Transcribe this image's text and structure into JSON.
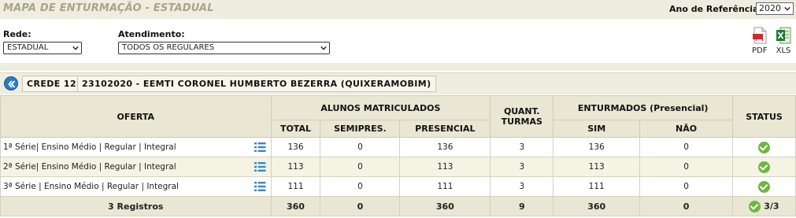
{
  "header": {
    "title": "MAPA DE ENTURMAÇÃO - ESTADUAL",
    "ano_label": "Ano de Referência:",
    "ano_value": "2020"
  },
  "filters": {
    "rede_label": "Rede:",
    "rede_value": "ESTADUAL",
    "atendimento_label": "Atendimento:",
    "atendimento_value": "TODOS OS REGULARES"
  },
  "export": {
    "pdf_label": "PDF",
    "xls_label": "XLS"
  },
  "breadcrumb": {
    "crede": "CREDE 12",
    "escola": "23102020 - EEMTI CORONEL HUMBERTO BEZERRA (QUIXERAMOBIM)"
  },
  "table": {
    "headers": {
      "oferta": "OFERTA",
      "alunos": "ALUNOS MATRICULADOS",
      "total": "TOTAL",
      "semipres": "SEMIPRES.",
      "presencial": "PRESENCIAL",
      "quant_turmas_1": "QUANT.",
      "quant_turmas_2": "TURMAS",
      "enturmados": "ENTURMADOS (Presencial)",
      "sim": "SIM",
      "nao": "NÃO",
      "status": "STATUS"
    },
    "rows": [
      {
        "oferta": "1ª Série| Ensino Médio | Regular | Integral",
        "total": "136",
        "semipres": "0",
        "presencial": "136",
        "turmas": "3",
        "sim": "136",
        "nao": "0"
      },
      {
        "oferta": "2ª Série| Ensino Médio | Regular | Integral",
        "total": "113",
        "semipres": "0",
        "presencial": "113",
        "turmas": "3",
        "sim": "113",
        "nao": "0"
      },
      {
        "oferta": "3ª Série | Ensino Médio | Regular | Integral",
        "total": "111",
        "semipres": "0",
        "presencial": "111",
        "turmas": "3",
        "sim": "111",
        "nao": "0"
      }
    ],
    "footer": {
      "registros": "3 Registros",
      "total": "360",
      "semipres": "0",
      "presencial": "360",
      "turmas": "9",
      "sim": "360",
      "nao": "0",
      "status": "3/3"
    }
  },
  "colors": {
    "title": "#a8a487",
    "band": "#eeede0",
    "status_ok": "#6fb63f",
    "list_icon": "#3c86c9"
  },
  "icons": {
    "back": "double-chevron-left-icon",
    "pdf": "pdf-file-icon",
    "xls": "excel-file-icon",
    "list": "list-icon",
    "status": "check-circle-icon"
  }
}
